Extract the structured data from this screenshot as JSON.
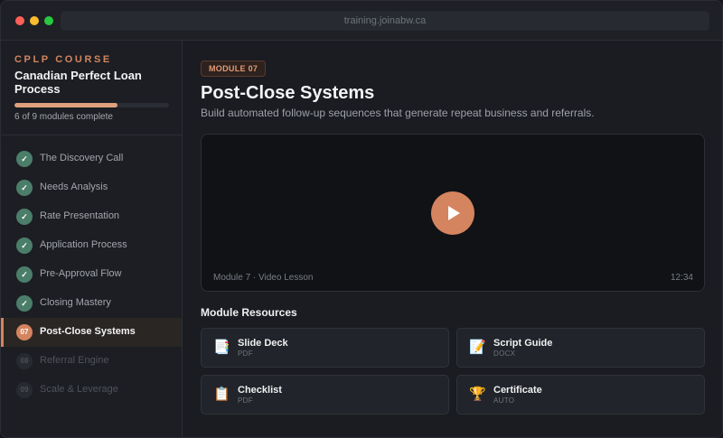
{
  "browser": {
    "url": "training.joinabw.ca"
  },
  "course": {
    "tag": "CPLP COURSE",
    "title": "Canadian Perfect Loan Process",
    "progress": 0.667,
    "progress_text": "6 of 9 modules complete"
  },
  "modules": [
    {
      "label": "The Discovery Call",
      "status": "done",
      "badge": "✓"
    },
    {
      "label": "Needs Analysis",
      "status": "done",
      "badge": "✓"
    },
    {
      "label": "Rate Presentation",
      "status": "done",
      "badge": "✓"
    },
    {
      "label": "Application Process",
      "status": "done",
      "badge": "✓"
    },
    {
      "label": "Pre-Approval Flow",
      "status": "done",
      "badge": "✓"
    },
    {
      "label": "Closing Mastery",
      "status": "done",
      "badge": "✓"
    },
    {
      "label": "Post-Close Systems",
      "status": "current",
      "badge": "07"
    },
    {
      "label": "Referral Engine",
      "status": "locked",
      "badge": "08"
    },
    {
      "label": "Scale & Leverage",
      "status": "locked",
      "badge": "09"
    }
  ],
  "main": {
    "module_pill": "MODULE 07",
    "title": "Post-Close Systems",
    "subtitle": "Build automated follow-up sequences that generate repeat business and referrals.",
    "video": {
      "caption": "Module 7 · Video Lesson",
      "duration": "12:34"
    },
    "resources_heading": "Module Resources",
    "resources": [
      {
        "icon": "slides-icon",
        "glyph": "📑",
        "title": "Slide Deck",
        "type": "PDF"
      },
      {
        "icon": "script-icon",
        "glyph": "📝",
        "title": "Script Guide",
        "type": "DOCX"
      },
      {
        "icon": "clipboard-icon",
        "glyph": "📋",
        "title": "Checklist",
        "type": "PDF"
      },
      {
        "icon": "trophy-icon",
        "glyph": "🏆",
        "title": "Certificate",
        "type": "AUTO"
      }
    ]
  },
  "colors": {
    "accent": "#d4845f",
    "done": "#4b7e6a",
    "background": "#1a1c21"
  }
}
